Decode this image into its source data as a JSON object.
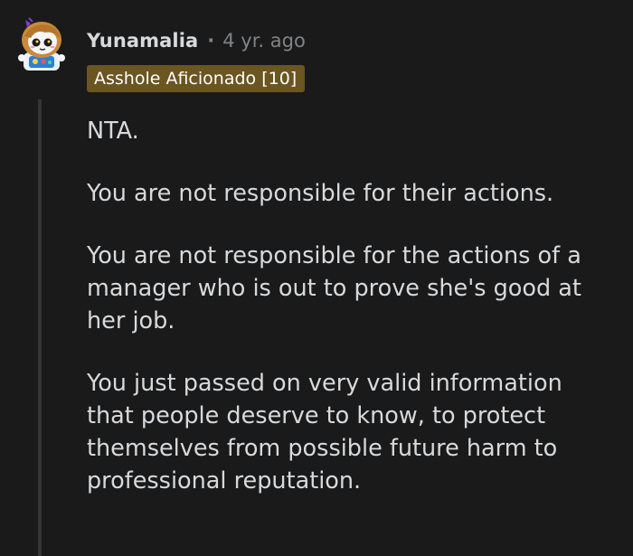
{
  "comment": {
    "author": "Yunamalia",
    "separator": "·",
    "age": "4 yr. ago",
    "flair": "Asshole Aficionado [10]",
    "avatar_icon": "snoo-avatar-icon",
    "colors": {
      "background": "#1a1a1b",
      "text": "#d7dadc",
      "meta": "#818384",
      "flair_bg": "#6b5520",
      "flair_text": "#ffffff",
      "thread_line": "#343536"
    },
    "paragraphs": [
      [
        "NTA."
      ],
      [
        "You are not responsible for their actions."
      ],
      [
        "You are not responsible for the actions of a",
        "manager who is out to prove she's good at",
        "her job."
      ],
      [
        "You just passed on very valid information",
        "that people deserve to know, to protect",
        "themselves from possible future harm to",
        "professional reputation."
      ]
    ]
  }
}
